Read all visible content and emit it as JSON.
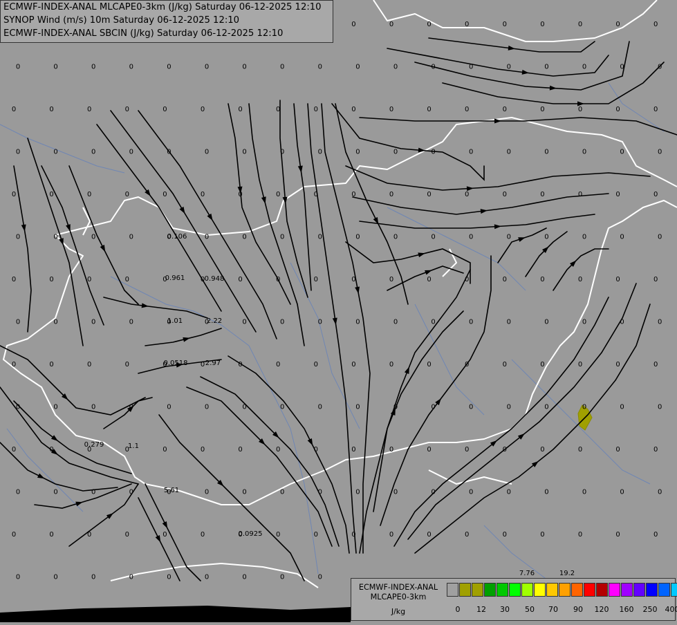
{
  "title_lines": [
    "ECMWF-INDEX-ANAL MLCAPE0-3km (J/kg) Saturday 06-12-2025 12:10",
    "SYNOP Wind (m/s) 10m Saturday 06-12-2025 12:10",
    "ECMWF-INDEX-ANAL SBCIN (J/kg) Saturday 06-12-2025 12:10"
  ],
  "legend": {
    "title_lines": [
      "ECMWF-INDEX-ANAL",
      "MLCAPE0-3km"
    ],
    "units": "J/kg",
    "colors": [
      "#a0a0a0",
      "#a0a000",
      "#a0a000",
      "#00a000",
      "#00c800",
      "#00ff00",
      "#a0ff00",
      "#ffff00",
      "#ffc800",
      "#ffa000",
      "#ff6400",
      "#ff0000",
      "#b40000",
      "#ff00ff",
      "#a000ff",
      "#6400ff",
      "#0000ff",
      "#0064ff",
      "#00c8ff",
      "#64ffff",
      "#ffffff"
    ],
    "ticks": [
      "0",
      "12",
      "30",
      "50",
      "70",
      "90",
      "120",
      "160",
      "250",
      "400"
    ]
  },
  "map_values": [
    "0",
    "0",
    "0",
    "0",
    "0",
    "0",
    "0",
    "0",
    "0",
    "0",
    "0",
    "0",
    "0.106",
    "0.961",
    "0.948",
    "1.01",
    "2.22",
    "0.0518",
    "2.97",
    "0.279",
    "1.1",
    "5.61",
    "0.0925",
    "7.76",
    "19.2"
  ],
  "colors": {
    "background": "#9a9a9a",
    "streamline": "#000000",
    "border": "#ffffff",
    "river": "#6f86b4",
    "cape_patch": "#a0a000"
  }
}
